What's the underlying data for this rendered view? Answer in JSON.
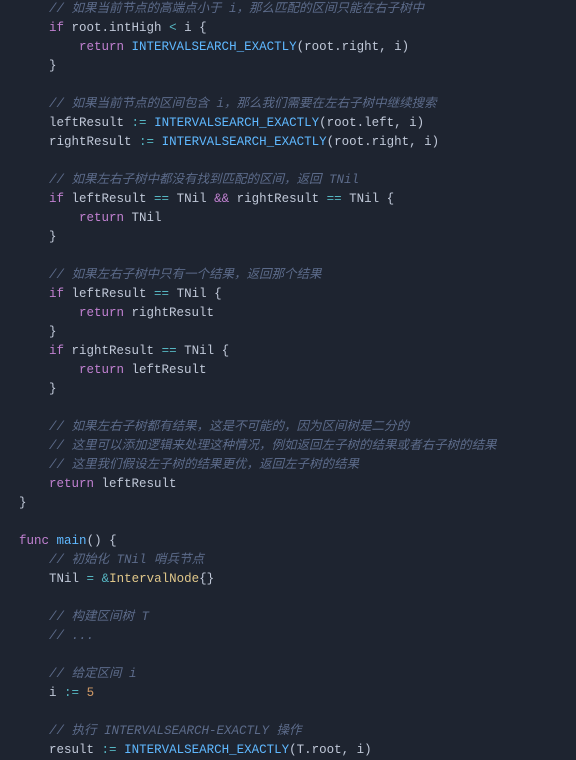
{
  "lines": [
    {
      "ind": 4,
      "seg": [
        {
          "c": "cmt",
          "t": "// 如果当前节点的高端点小于 i，那么匹配的区间只能在右子树中"
        }
      ]
    },
    {
      "ind": 4,
      "seg": [
        {
          "c": "kw",
          "t": "if"
        },
        {
          "c": "id",
          "t": " root.intHigh "
        },
        {
          "c": "op",
          "t": "<"
        },
        {
          "c": "id",
          "t": " i "
        },
        {
          "c": "pn",
          "t": "{"
        }
      ]
    },
    {
      "ind": 8,
      "seg": [
        {
          "c": "kw",
          "t": "return"
        },
        {
          "c": "id",
          "t": " "
        },
        {
          "c": "fn",
          "t": "INTERVALSEARCH_EXACTLY"
        },
        {
          "c": "pn",
          "t": "("
        },
        {
          "c": "id",
          "t": "root.right, i"
        },
        {
          "c": "pn",
          "t": ")"
        }
      ]
    },
    {
      "ind": 4,
      "seg": [
        {
          "c": "pn",
          "t": "}"
        }
      ]
    },
    {
      "ind": 0,
      "seg": [
        {
          "c": "id",
          "t": ""
        }
      ]
    },
    {
      "ind": 4,
      "seg": [
        {
          "c": "cmt",
          "t": "// 如果当前节点的区间包含 i，那么我们需要在左右子树中继续搜索"
        }
      ]
    },
    {
      "ind": 4,
      "seg": [
        {
          "c": "id",
          "t": "leftResult "
        },
        {
          "c": "op",
          "t": ":="
        },
        {
          "c": "id",
          "t": " "
        },
        {
          "c": "fn",
          "t": "INTERVALSEARCH_EXACTLY"
        },
        {
          "c": "pn",
          "t": "("
        },
        {
          "c": "id",
          "t": "root.left, i"
        },
        {
          "c": "pn",
          "t": ")"
        }
      ]
    },
    {
      "ind": 4,
      "seg": [
        {
          "c": "id",
          "t": "rightResult "
        },
        {
          "c": "op",
          "t": ":="
        },
        {
          "c": "id",
          "t": " "
        },
        {
          "c": "fn",
          "t": "INTERVALSEARCH_EXACTLY"
        },
        {
          "c": "pn",
          "t": "("
        },
        {
          "c": "id",
          "t": "root.right, i"
        },
        {
          "c": "pn",
          "t": ")"
        }
      ]
    },
    {
      "ind": 0,
      "seg": [
        {
          "c": "id",
          "t": ""
        }
      ]
    },
    {
      "ind": 4,
      "seg": [
        {
          "c": "cmt",
          "t": "// 如果左右子树中都没有找到匹配的区间，返回 TNil"
        }
      ]
    },
    {
      "ind": 4,
      "seg": [
        {
          "c": "kw",
          "t": "if"
        },
        {
          "c": "id",
          "t": " leftResult "
        },
        {
          "c": "op",
          "t": "=="
        },
        {
          "c": "id",
          "t": " TNil "
        },
        {
          "c": "log",
          "t": "&&"
        },
        {
          "c": "id",
          "t": " rightResult "
        },
        {
          "c": "op",
          "t": "=="
        },
        {
          "c": "id",
          "t": " TNil "
        },
        {
          "c": "pn",
          "t": "{"
        }
      ]
    },
    {
      "ind": 8,
      "seg": [
        {
          "c": "kw",
          "t": "return"
        },
        {
          "c": "id",
          "t": " TNil"
        }
      ]
    },
    {
      "ind": 4,
      "seg": [
        {
          "c": "pn",
          "t": "}"
        }
      ]
    },
    {
      "ind": 0,
      "seg": [
        {
          "c": "id",
          "t": ""
        }
      ]
    },
    {
      "ind": 4,
      "seg": [
        {
          "c": "cmt",
          "t": "// 如果左右子树中只有一个结果，返回那个结果"
        }
      ]
    },
    {
      "ind": 4,
      "seg": [
        {
          "c": "kw",
          "t": "if"
        },
        {
          "c": "id",
          "t": " leftResult "
        },
        {
          "c": "op",
          "t": "=="
        },
        {
          "c": "id",
          "t": " TNil "
        },
        {
          "c": "pn",
          "t": "{"
        }
      ]
    },
    {
      "ind": 8,
      "seg": [
        {
          "c": "kw",
          "t": "return"
        },
        {
          "c": "id",
          "t": " rightResult"
        }
      ]
    },
    {
      "ind": 4,
      "seg": [
        {
          "c": "pn",
          "t": "}"
        }
      ]
    },
    {
      "ind": 4,
      "seg": [
        {
          "c": "kw",
          "t": "if"
        },
        {
          "c": "id",
          "t": " rightResult "
        },
        {
          "c": "op",
          "t": "=="
        },
        {
          "c": "id",
          "t": " TNil "
        },
        {
          "c": "pn",
          "t": "{"
        }
      ]
    },
    {
      "ind": 8,
      "seg": [
        {
          "c": "kw",
          "t": "return"
        },
        {
          "c": "id",
          "t": " leftResult"
        }
      ]
    },
    {
      "ind": 4,
      "seg": [
        {
          "c": "pn",
          "t": "}"
        }
      ]
    },
    {
      "ind": 0,
      "seg": [
        {
          "c": "id",
          "t": ""
        }
      ]
    },
    {
      "ind": 4,
      "seg": [
        {
          "c": "cmt",
          "t": "// 如果左右子树都有结果，这是不可能的，因为区间树是二分的"
        }
      ]
    },
    {
      "ind": 4,
      "seg": [
        {
          "c": "cmt",
          "t": "// 这里可以添加逻辑来处理这种情况，例如返回左子树的结果或者右子树的结果"
        }
      ]
    },
    {
      "ind": 4,
      "seg": [
        {
          "c": "cmt",
          "t": "// 这里我们假设左子树的结果更优，返回左子树的结果"
        }
      ]
    },
    {
      "ind": 4,
      "seg": [
        {
          "c": "kw",
          "t": "return"
        },
        {
          "c": "id",
          "t": " leftResult"
        }
      ]
    },
    {
      "ind": 0,
      "seg": [
        {
          "c": "pn",
          "t": "}"
        }
      ]
    },
    {
      "ind": 0,
      "seg": [
        {
          "c": "id",
          "t": ""
        }
      ]
    },
    {
      "ind": 0,
      "seg": [
        {
          "c": "kw",
          "t": "func"
        },
        {
          "c": "id",
          "t": " "
        },
        {
          "c": "fn",
          "t": "main"
        },
        {
          "c": "pn",
          "t": "() {"
        }
      ]
    },
    {
      "ind": 4,
      "seg": [
        {
          "c": "cmt",
          "t": "// 初始化 TNil 哨兵节点"
        }
      ]
    },
    {
      "ind": 4,
      "seg": [
        {
          "c": "id",
          "t": "TNil "
        },
        {
          "c": "op",
          "t": "="
        },
        {
          "c": "id",
          "t": " "
        },
        {
          "c": "amp",
          "t": "&"
        },
        {
          "c": "typ",
          "t": "IntervalNode"
        },
        {
          "c": "pn",
          "t": "{}"
        }
      ]
    },
    {
      "ind": 0,
      "seg": [
        {
          "c": "id",
          "t": ""
        }
      ]
    },
    {
      "ind": 4,
      "seg": [
        {
          "c": "cmt",
          "t": "// 构建区间树 T"
        }
      ]
    },
    {
      "ind": 4,
      "seg": [
        {
          "c": "cmt",
          "t": "// ..."
        }
      ]
    },
    {
      "ind": 0,
      "seg": [
        {
          "c": "id",
          "t": ""
        }
      ]
    },
    {
      "ind": 4,
      "seg": [
        {
          "c": "cmt",
          "t": "// 给定区间 i"
        }
      ]
    },
    {
      "ind": 4,
      "seg": [
        {
          "c": "id",
          "t": "i "
        },
        {
          "c": "op",
          "t": ":="
        },
        {
          "c": "id",
          "t": " "
        },
        {
          "c": "num",
          "t": "5"
        }
      ]
    },
    {
      "ind": 0,
      "seg": [
        {
          "c": "id",
          "t": ""
        }
      ]
    },
    {
      "ind": 4,
      "seg": [
        {
          "c": "cmt",
          "t": "// 执行 INTERVALSEARCH-EXACTLY 操作"
        }
      ]
    },
    {
      "ind": 4,
      "seg": [
        {
          "c": "id",
          "t": "result "
        },
        {
          "c": "op",
          "t": ":="
        },
        {
          "c": "id",
          "t": " "
        },
        {
          "c": "fn",
          "t": "INTERVALSEARCH_EXACTLY"
        },
        {
          "c": "pn",
          "t": "("
        },
        {
          "c": "id",
          "t": "T.root, i"
        },
        {
          "c": "pn",
          "t": ")"
        }
      ]
    }
  ]
}
